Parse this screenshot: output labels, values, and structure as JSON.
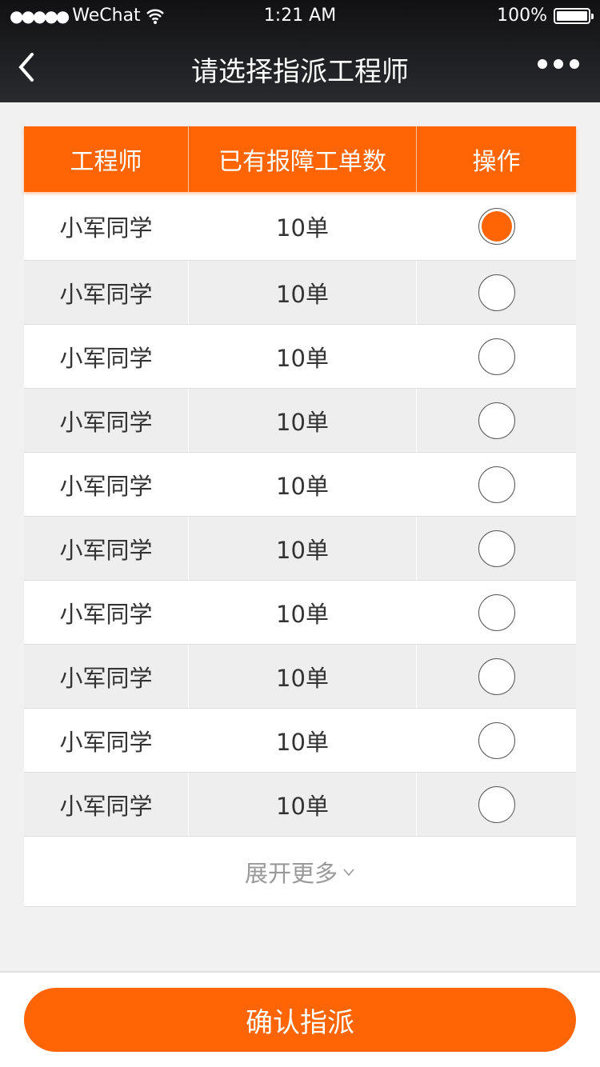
{
  "status_bar": {
    "carrier": "WeChat",
    "time": "1:21 AM",
    "battery": "100%",
    "signal_dots": "●●●●●"
  },
  "nav": {
    "title": "请选择指派工程师"
  },
  "table": {
    "headers": [
      "工程师",
      "已有报障工单数",
      "操作"
    ],
    "rows": [
      {
        "name": "小军同学",
        "count": "10单",
        "selected": true
      },
      {
        "name": "小军同学",
        "count": "10单",
        "selected": false
      },
      {
        "name": "小军同学",
        "count": "10单",
        "selected": false
      },
      {
        "name": "小军同学",
        "count": "10单",
        "selected": false
      },
      {
        "name": "小军同学",
        "count": "10单",
        "selected": false
      },
      {
        "name": "小军同学",
        "count": "10单",
        "selected": false
      },
      {
        "name": "小军同学",
        "count": "10单",
        "selected": false
      },
      {
        "name": "小军同学",
        "count": "10单",
        "selected": false
      },
      {
        "name": "小军同学",
        "count": "10单",
        "selected": false
      },
      {
        "name": "小军同学",
        "count": "10单",
        "selected": false
      }
    ],
    "expand_label": "展开更多"
  },
  "footer": {
    "confirm_label": "确认指派"
  },
  "colors": {
    "accent": "#ff6505"
  }
}
